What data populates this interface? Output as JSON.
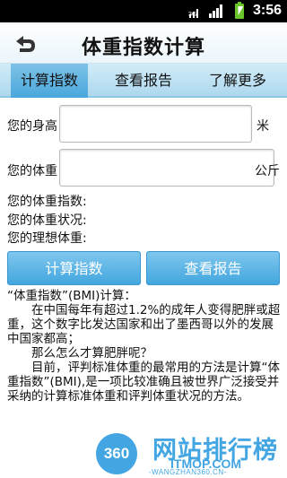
{
  "status_bar": {
    "network": "3G",
    "time": "3:56",
    "icons": [
      "signal-icon",
      "wifi-bars-icon",
      "battery-charging-icon"
    ]
  },
  "header": {
    "title": "体重指数计算",
    "back_icon": "back-arrow-icon"
  },
  "tabs": [
    {
      "label": "计算指数",
      "active": true
    },
    {
      "label": "查看报告",
      "active": false
    },
    {
      "label": "了解更多",
      "active": false
    }
  ],
  "form": {
    "height_label": "您的身高",
    "height_value": "",
    "height_unit": "米",
    "weight_label": "您的体重",
    "weight_value": "",
    "weight_unit": "公斤"
  },
  "results": {
    "bmi_label": "您的体重指数:",
    "status_label": "您的体重状况:",
    "ideal_label": "您的理想体重:"
  },
  "buttons": {
    "calc": "计算指数",
    "report": "查看报告"
  },
  "description": {
    "heading": "“体重指数”(BMI)计算：",
    "p1": "在中国每年有超过1.2%的成年人变得肥胖或超重，这个数字比发达国家和出了墨西哥以外的发展中国家都高；",
    "p2": "那么怎么才算肥胖呢？",
    "p3": "目前，评判标准体重的最常用的方法是计算“体重指数”(BMI),是一项比较准确且被世界广泛接受并采纳的计算标准体重和评判体重状况的方法。"
  },
  "watermark": {
    "badge": "360",
    "title": "网站排行榜",
    "domain": "ITMOP.COM",
    "sub": "-WANGZHAN360.CN-"
  },
  "colors": {
    "accent": "#43a6de",
    "tab_bg": "#aed8ee",
    "battery": "#6ac52a"
  }
}
